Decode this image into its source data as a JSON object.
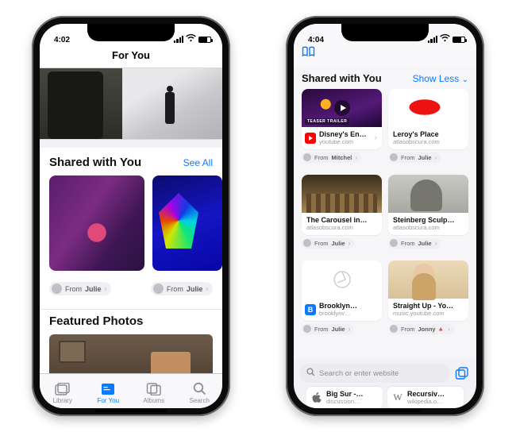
{
  "phone1": {
    "status_time": "4:02",
    "nav_title": "For You",
    "shared_title": "Shared with You",
    "see_all": "See All",
    "from_label_prefix": "From",
    "from1": "Julie",
    "from2": "Julie",
    "featured_title": "Featured Photos",
    "tabs": {
      "library": "Library",
      "foryou": "For You",
      "albums": "Albums",
      "search": "Search"
    }
  },
  "phone2": {
    "status_time": "4:04",
    "shared_title": "Shared with You",
    "show_less": "Show Less",
    "cards": [
      {
        "title": "Disney's En…",
        "subtitle": "youtube.com",
        "from": "Mitchel",
        "kind": "disney",
        "fav": "red",
        "disclosure": true
      },
      {
        "title": "Leroy's Place",
        "subtitle": "atlasobscura.com",
        "from": "Julie",
        "kind": "leroy"
      },
      {
        "title": "The Carousel in…",
        "subtitle": "atlasobscura.com",
        "from": "Julie",
        "kind": "carousel"
      },
      {
        "title": "Steinberg Sculp…",
        "subtitle": "atlasobscura.com",
        "from": "Julie",
        "kind": "sculpt"
      },
      {
        "title": "Brooklyn…",
        "subtitle": "brooklynv…",
        "from": "Julie",
        "kind": "blank",
        "fav": "blue",
        "favletter": "B"
      },
      {
        "title": "Straight Up - Yo…",
        "subtitle": "music.youtube.com",
        "from": "Jonny 🔺",
        "kind": "paula"
      }
    ],
    "from_label_prefix": "From",
    "search_placeholder": "Search or enter website",
    "open_tabs": [
      {
        "title": "Big Sur -…",
        "subtitle": "discussion…",
        "icon": "apple"
      },
      {
        "title": "Recursiv…",
        "subtitle": "wikipedia.o…",
        "icon": "wiki"
      }
    ]
  }
}
